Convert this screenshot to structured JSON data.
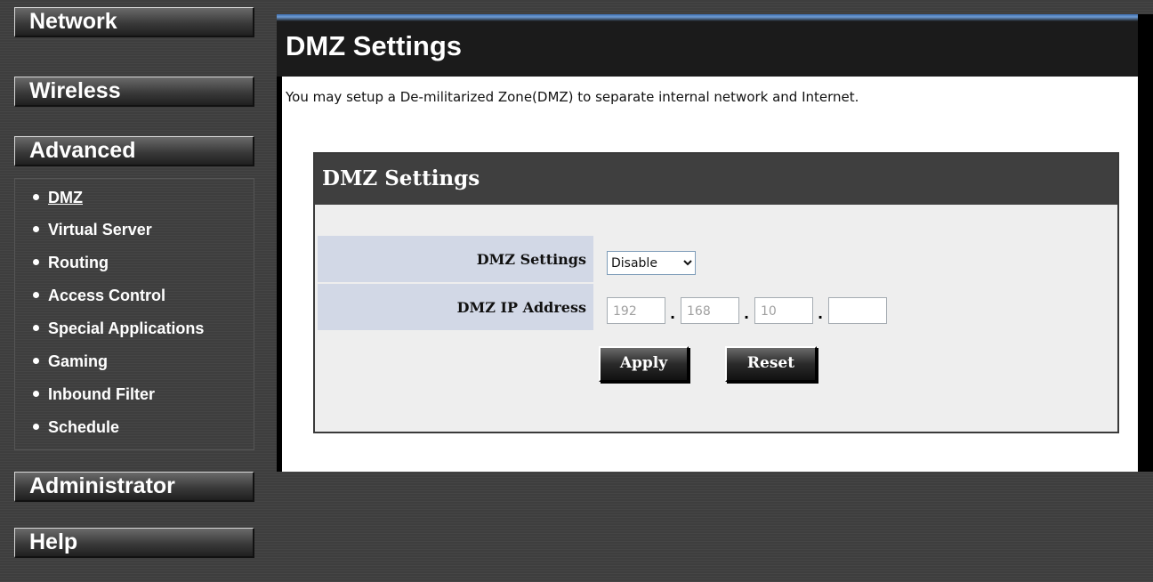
{
  "sidebar": {
    "menu": [
      {
        "label": "Network"
      },
      {
        "label": "Wireless"
      },
      {
        "label": "Advanced"
      },
      {
        "label": "Administrator"
      },
      {
        "label": "Help"
      }
    ],
    "submenu": [
      {
        "label": "DMZ",
        "active": true
      },
      {
        "label": "Virtual Server"
      },
      {
        "label": "Routing"
      },
      {
        "label": "Access Control"
      },
      {
        "label": "Special Applications"
      },
      {
        "label": "Gaming"
      },
      {
        "label": "Inbound Filter"
      },
      {
        "label": "Schedule"
      }
    ]
  },
  "main": {
    "title": "DMZ Settings",
    "description": "You may setup a De-militarized Zone(DMZ) to separate internal network and Internet.",
    "box": {
      "title": "DMZ Settings",
      "dmz_settings_label": "DMZ Settings",
      "dmz_settings_value": "Disable",
      "dmz_settings_options": [
        "Disable"
      ],
      "ip_label": "DMZ IP Address",
      "ip_octets": [
        "192",
        "168",
        "10",
        ""
      ],
      "ip_separator": ".",
      "apply_label": "Apply",
      "reset_label": "Reset"
    }
  },
  "colors": {
    "background": "#3c3c3c",
    "title_bar": "#1b1b1b",
    "title_accent": "#6e9bd4",
    "label_cell": "#d2d8e6",
    "box_body": "#eeeeee"
  }
}
